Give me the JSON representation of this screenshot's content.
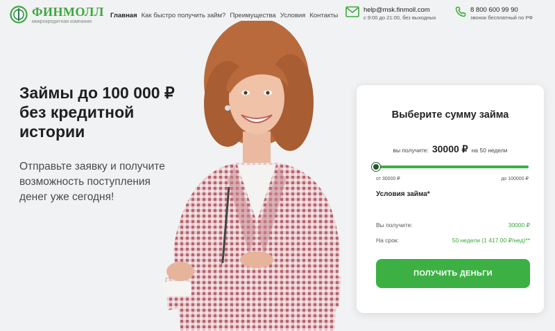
{
  "brand": {
    "name": "ФИНМОЛЛ",
    "tagline": "микрокредитная компания",
    "color": "#3aa83c"
  },
  "nav": {
    "items": [
      {
        "label": "Главная",
        "active": true
      },
      {
        "label": "Как быстро получить займ?",
        "active": false
      },
      {
        "label": "Преимущества",
        "active": false
      },
      {
        "label": "Условия",
        "active": false
      },
      {
        "label": "Контакты",
        "active": false
      }
    ]
  },
  "contacts": {
    "email": "help@msk.finmoll.com",
    "email_hours": "с 9:00 до 21:00, без выходных",
    "email_icon": "mail-icon",
    "phone": "8 800 600 99 90",
    "phone_note": "звонок бесплатный по РФ",
    "phone_icon": "phone-icon"
  },
  "hero": {
    "headline": [
      "Займы до 100 000 ₽",
      "без кредитной",
      "истории"
    ],
    "subline": [
      "Отправьте заявку и получите",
      "возможность поступления",
      "денег уже сегодня!"
    ]
  },
  "loan_form": {
    "title": "Выберите сумму займа",
    "you_get_label": "вы получите:",
    "amount": "30000 ₽",
    "term_suffix": "на 50 недели",
    "slider": {
      "min_label": "от 30000 ₽",
      "max_label": "до 100000 ₽",
      "position": 0.0
    },
    "terms_title": "Условия займа*",
    "terms": [
      {
        "label": "Вы получите:",
        "value": "30000 ₽"
      },
      {
        "label": "На срок:",
        "value": "50 недели (1 417.00 ₽/нед)**"
      }
    ],
    "button_label": "ПОЛУЧИТЬ ДЕНЬГИ",
    "accent": "#3cb043"
  }
}
